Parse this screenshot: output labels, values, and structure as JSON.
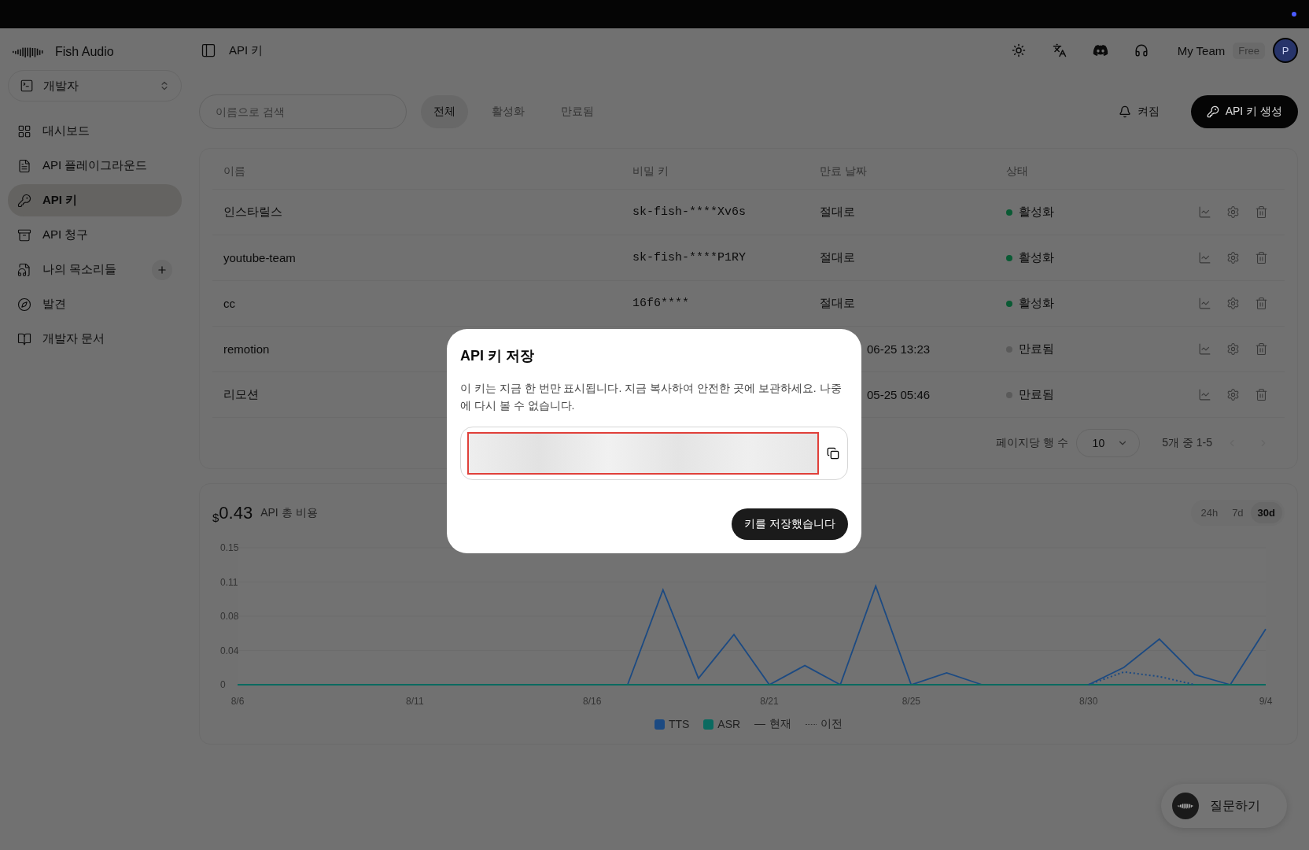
{
  "brand": {
    "name": "Fish Audio"
  },
  "workspace": {
    "label": "개발자"
  },
  "sidebar": {
    "items": [
      {
        "label": "대시보드",
        "selected": false
      },
      {
        "label": "API 플레이그라운드",
        "selected": false
      },
      {
        "label": "API 키",
        "selected": true
      },
      {
        "label": "API 청구",
        "selected": false
      },
      {
        "label": "나의 목소리들",
        "selected": false,
        "add": true
      },
      {
        "label": "발견",
        "selected": false
      },
      {
        "label": "개발자 문서",
        "selected": false
      }
    ]
  },
  "header": {
    "title": "API 키",
    "team": "My Team",
    "plan": "Free",
    "avatar": "P"
  },
  "toolbar": {
    "search": {
      "placeholder": "이름으로 검색"
    },
    "filters": [
      {
        "label": "전체",
        "selected": true
      },
      {
        "label": "활성화",
        "selected": false
      },
      {
        "label": "만료됨",
        "selected": false
      }
    ],
    "notify": "켜짐",
    "create": "API 키 생성"
  },
  "table": {
    "columns": [
      "이름",
      "비밀 키",
      "만료 날짜",
      "상태"
    ],
    "rows": [
      {
        "name": "인스타릴스",
        "secret": "sk-fish-****Xv6s",
        "expiry": "절대로",
        "status": "활성화",
        "active": true
      },
      {
        "name": "youtube-team",
        "secret": "sk-fish-****P1RY",
        "expiry": "절대로",
        "status": "활성화",
        "active": true
      },
      {
        "name": "cc",
        "secret": "16f6****",
        "expiry": "절대로",
        "status": "활성화",
        "active": true
      },
      {
        "name": "remotion",
        "expiry": "06-25 13:23",
        "status": "만료됨",
        "active": false
      },
      {
        "name": "리모션",
        "expiry": "05-25 05:46",
        "status": "만료됨",
        "active": false
      }
    ],
    "pagination": {
      "label": "페이지당 행 수",
      "page_size": "10",
      "range": "5개 중 1-5"
    }
  },
  "usage": {
    "currency": "$",
    "amount": "0.43",
    "label": "API 총 비용",
    "periods": [
      {
        "label": "24h",
        "selected": false
      },
      {
        "label": "7d",
        "selected": false
      },
      {
        "label": "30d",
        "selected": true
      }
    ],
    "chart_data": {
      "type": "line",
      "categories": [
        "8/6",
        null,
        null,
        null,
        null,
        "8/11",
        null,
        null,
        null,
        null,
        "8/16",
        null,
        null,
        null,
        null,
        "8/21",
        null,
        null,
        null,
        "8/25",
        null,
        null,
        null,
        null,
        "8/30",
        null,
        null,
        null,
        null,
        "9/4"
      ],
      "yticks": [
        0,
        {
          "value": 0.0375,
          "label": "0.04"
        },
        {
          "value": 0.075,
          "label": "0.08"
        },
        {
          "value": 0.1125,
          "label": "0.11"
        },
        {
          "value": 0.15,
          "label": "0.15"
        }
      ],
      "ylim": [
        0,
        0.15
      ],
      "series": [
        {
          "name": "TTS",
          "color": "#1c4a82",
          "values": [
            null,
            null,
            null,
            null,
            null,
            null,
            null,
            null,
            null,
            null,
            null,
            0,
            0.104,
            0.007,
            0.055,
            0,
            0.021,
            0,
            0.108,
            0,
            0.013,
            0,
            null,
            null,
            0,
            0.019,
            0.05,
            0.011,
            0,
            0.061
          ]
        },
        {
          "name": "ASR",
          "color": "#0b6a60",
          "values": [
            0,
            0,
            0,
            0,
            0,
            0,
            0,
            0,
            0,
            0,
            0,
            0,
            0,
            0,
            0,
            0,
            0,
            0,
            0,
            0,
            0,
            0,
            0,
            0,
            0,
            0,
            0,
            0,
            0,
            0
          ]
        },
        {
          "name": "이전",
          "color": "#1c4a82",
          "line_style": "dotted",
          "values": [
            null,
            null,
            null,
            null,
            null,
            null,
            null,
            null,
            null,
            null,
            null,
            null,
            null,
            null,
            null,
            null,
            null,
            null,
            null,
            null,
            null,
            null,
            null,
            null,
            0,
            0.014,
            0.009,
            0,
            null,
            null
          ]
        }
      ]
    },
    "current_label": "현재"
  },
  "ask": {
    "label": "질문하기"
  },
  "dialog": {
    "title": "API 키 저장",
    "message": "이 키는 지금 한 번만 표시됩니다. 지금 복사하여 안전한 곳에 보관하세요. 나중에 다시 볼 수 없습니다.",
    "confirm": "키를 저장했습니다"
  }
}
